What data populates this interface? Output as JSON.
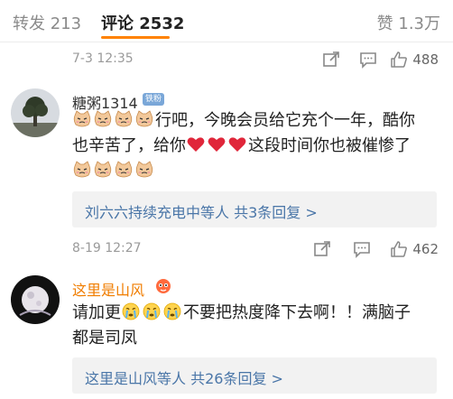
{
  "tabs": {
    "reposts": "转发 213",
    "comments": "评论 2532",
    "likes": "赞 1.3万"
  },
  "comments": [
    {
      "time": "7-3 12:35",
      "like_count": "488"
    },
    {
      "username": "糖粥1314",
      "badge": "铁粉",
      "line1_text": "行吧，今晚会员给它充个一年，酷你",
      "line2_a": "也辛苦了，给你",
      "line2_b": "这段时间你也被催惨了",
      "reply_summary": "刘六六持续充电中等人  共3条回复 >",
      "time": "8-19 12:27",
      "like_count": "462"
    },
    {
      "username": "这里是山风",
      "line1_a": "请加更",
      "line1_b": "不要把热度降下去啊！！满脑子",
      "line2": "都是司凤",
      "reply_summary": "这里是山风等人  共26条回复 >"
    }
  ],
  "colors": {
    "accent": "#ff8200",
    "link": "#4a76a8",
    "meta": "#9a9a9a",
    "heart": "#e0263a",
    "vip_name": "#f07d00"
  },
  "icons": [
    "share-icon",
    "comment-icon",
    "like-icon",
    "cat-emoji",
    "heart-emoji",
    "crying-emoji",
    "spirit-emoji"
  ]
}
